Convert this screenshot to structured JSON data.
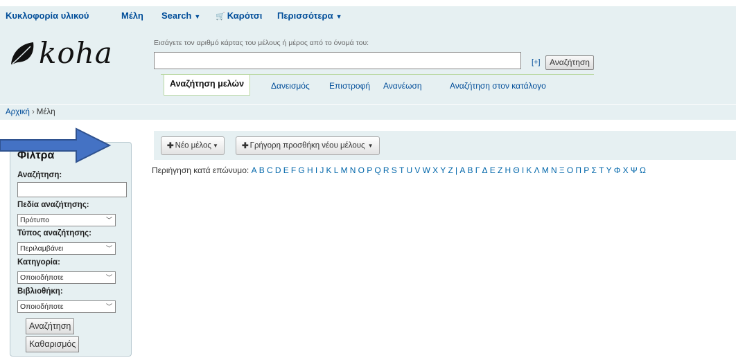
{
  "top_nav": {
    "circulation": "Κυκλοφορία υλικού",
    "patrons": "Μέλη",
    "search": "Search",
    "cart": "Καρότσι",
    "more": "Περισσότερα"
  },
  "logo_text": "koha",
  "search_box": {
    "hint": "Εισάγετε τον αριθμό κάρτας του μέλους ή μέρος από το όνομά του:",
    "value": "",
    "advanced_toggle": "[+]",
    "submit_label": "Αναζήτηση"
  },
  "tabs": [
    {
      "label": "Αναζήτηση μελών",
      "active": true
    },
    {
      "label": "Δανεισμός"
    },
    {
      "label": "Επιστροφή"
    },
    {
      "label": "Ανανέωση"
    },
    {
      "label": "Αναζήτηση στον κατάλογο"
    }
  ],
  "breadcrumb": {
    "home": "Αρχική",
    "separator": "›",
    "current": "Μέλη"
  },
  "filters": {
    "title": "Φίλτρα",
    "search_label": "Αναζήτηση:",
    "search_value": "",
    "fields_label": "Πεδία αναζήτησης:",
    "fields_value": "Πρότυπο",
    "type_label": "Τύπος αναζήτησης:",
    "type_value": "Περιλαμβάνει",
    "category_label": "Κατηγορία:",
    "category_value": "Οποιοδήποτε",
    "library_label": "Βιβλιοθήκη:",
    "library_value": "Οποιοδήποτε",
    "search_button": "Αναζήτηση",
    "clear_button": "Καθαρισμός"
  },
  "toolbar": {
    "new_patron": "Νέο μέλος",
    "quick_add": "Γρήγορη προσθήκη νέου μέλους"
  },
  "browse": {
    "label": "Περιήγηση κατά επώνυμο:",
    "latin_letters": [
      "A",
      "B",
      "C",
      "D",
      "E",
      "F",
      "G",
      "H",
      "I",
      "J",
      "K",
      "L",
      "M",
      "N",
      "O",
      "P",
      "Q",
      "R",
      "S",
      "T",
      "U",
      "V",
      "W",
      "X",
      "Y",
      "Z"
    ],
    "separator": "|",
    "greek_letters": [
      "Α",
      "Β",
      "Γ",
      "Δ",
      "Ε",
      "Ζ",
      "Η",
      "Θ",
      "Ι",
      "Κ",
      "Λ",
      "Μ",
      "Ν",
      "Ξ",
      "Ο",
      "Π",
      "Ρ",
      "Σ",
      "Τ",
      "Υ",
      "Φ",
      "Χ",
      "Ψ",
      "Ω"
    ]
  },
  "colors": {
    "header_bg": "#e6f0f2",
    "link": "#004d99",
    "arrow_fill": "#4472c4",
    "arrow_stroke": "#2f528f"
  }
}
